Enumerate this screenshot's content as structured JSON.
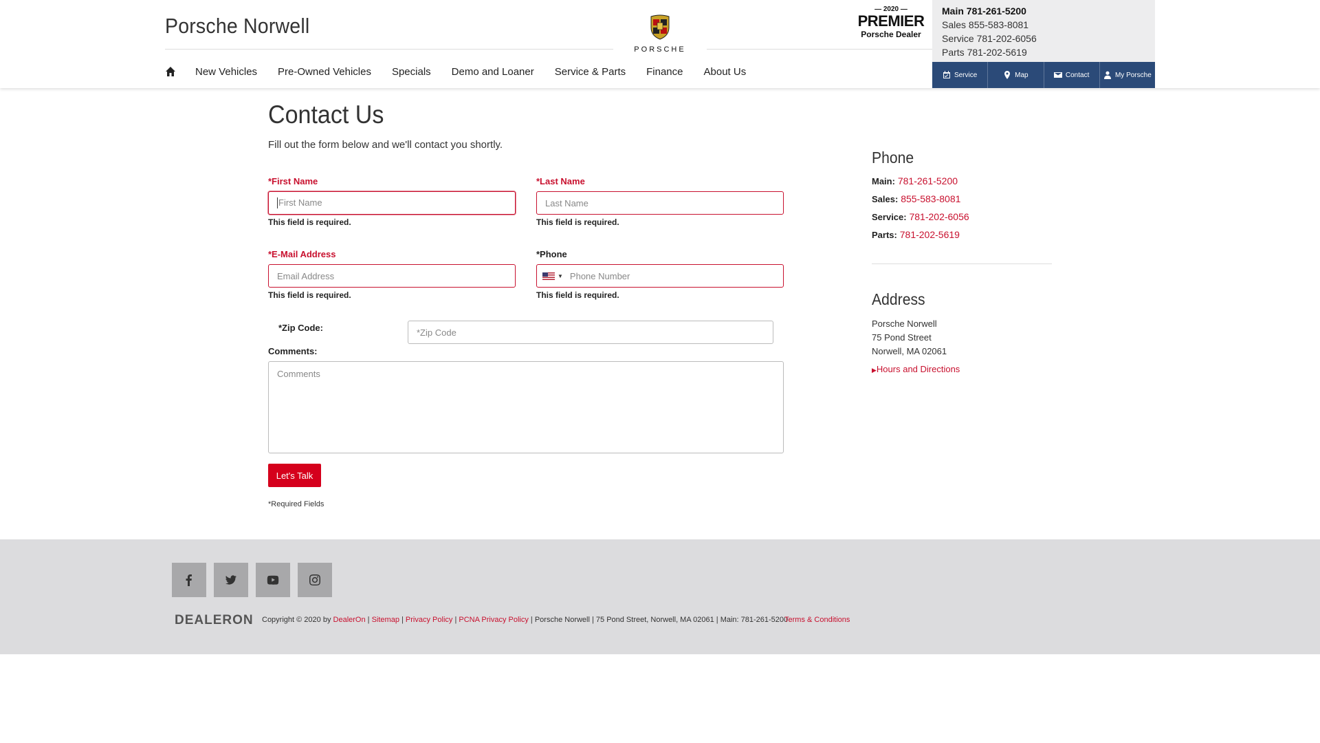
{
  "header": {
    "dealer_name": "Porsche Norwell",
    "logo_text": "PORSCHE",
    "premier": {
      "year": "— 2020 —",
      "title": "PREMIER",
      "subtitle": "Porsche Dealer"
    },
    "contact": {
      "main_label": "Main",
      "main": "781-261-5200",
      "sales": "Sales 855-583-8081",
      "service": "Service 781-202-6056",
      "parts": "Parts 781-202-5619"
    },
    "quick_links": [
      "Service",
      "Map",
      "Contact",
      "My Porsche"
    ],
    "nav": [
      "New Vehicles",
      "Pre-Owned Vehicles",
      "Specials",
      "Demo and Loaner",
      "Service & Parts",
      "Finance",
      "About Us"
    ]
  },
  "form": {
    "title": "Contact Us",
    "subtitle": "Fill out the form below and we'll contact you shortly.",
    "first_name": {
      "label": "*First Name",
      "placeholder": "First Name",
      "error": "This field is required."
    },
    "last_name": {
      "label": "*Last Name",
      "placeholder": "Last Name",
      "error": "This field is required."
    },
    "email": {
      "label": "*E-Mail Address",
      "placeholder": "Email Address",
      "error": "This field is required."
    },
    "phone": {
      "label": "*Phone",
      "placeholder": "Phone Number",
      "error": "This field is required."
    },
    "zip": {
      "label": "*Zip Code:",
      "placeholder": "*Zip Code"
    },
    "comments": {
      "label": "Comments:",
      "placeholder": "Comments"
    },
    "submit": "Let's Talk",
    "required_note": "*Required Fields"
  },
  "sidebar": {
    "phone_heading": "Phone",
    "phones": [
      {
        "label": "Main:",
        "number": "781-261-5200"
      },
      {
        "label": "Sales:",
        "number": "855-583-8081"
      },
      {
        "label": "Service:",
        "number": "781-202-6056"
      },
      {
        "label": "Parts:",
        "number": "781-202-5619"
      }
    ],
    "address_heading": "Address",
    "address_lines": [
      "Porsche Norwell",
      "75 Pond Street",
      "Norwell, MA 02061"
    ],
    "hours_link": "Hours and Directions"
  },
  "footer": {
    "brand": "DEALERON",
    "copyright_prefix": "Copyright © 2020 by",
    "dealeron_link": "DealerOn",
    "sitemap": "Sitemap",
    "privacy": "Privacy Policy",
    "pcna_privacy": "PCNA Privacy Policy",
    "info": "Porsche Norwell | 75 Pond Street, Norwell, MA 02061 | Main: 781-261-5200",
    "terms": "Terms & Conditions"
  },
  "colors": {
    "accent": "#c8102e",
    "button": "#d5001c",
    "quick_bar": "#2b4a78",
    "footer_bg": "#dcdcde"
  }
}
